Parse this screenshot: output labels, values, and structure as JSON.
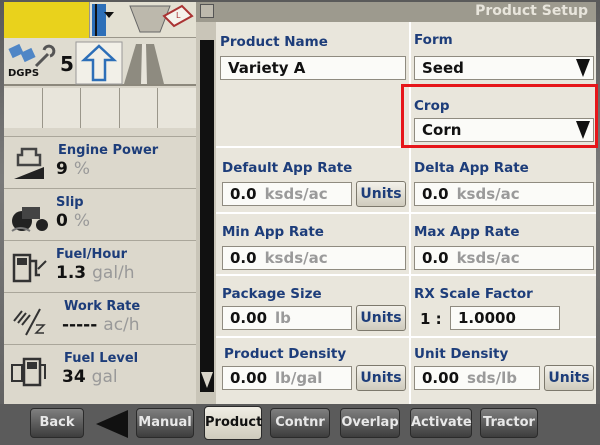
{
  "window": {
    "title": "Product Setup"
  },
  "status": {
    "gps_label": "DGPS",
    "satellite_count": "5",
    "engine_power": {
      "label": "Engine Power",
      "value": "9",
      "unit": "%"
    },
    "slip": {
      "label": "Slip",
      "value": "0",
      "unit": "%"
    },
    "fuel_hour": {
      "label": "Fuel/Hour",
      "value": "1.3",
      "unit": "gal/h"
    },
    "work_rate": {
      "label": "Work Rate",
      "value": "-----",
      "unit": "ac/h"
    },
    "fuel_level": {
      "label": "Fuel Level",
      "value": "34",
      "unit": "gal"
    }
  },
  "form": {
    "product_name": {
      "label": "Product Name",
      "value": "Variety A"
    },
    "form_type": {
      "label": "Form",
      "value": "Seed"
    },
    "crop": {
      "label": "Crop",
      "value": "Corn"
    },
    "default_app_rate": {
      "label": "Default App Rate",
      "value": "0.0",
      "unit": "ksds/ac"
    },
    "delta_app_rate": {
      "label": "Delta App Rate",
      "value": "0.0",
      "unit": "ksds/ac"
    },
    "min_app_rate": {
      "label": "Min App Rate",
      "value": "0.0",
      "unit": "ksds/ac"
    },
    "max_app_rate": {
      "label": "Max App Rate",
      "value": "0.0",
      "unit": "ksds/ac"
    },
    "package_size": {
      "label": "Package Size",
      "value": "0.00",
      "unit": "lb"
    },
    "rx_scale_factor": {
      "label": "RX Scale Factor",
      "prefix": "1 :",
      "value": "1.0000"
    },
    "product_density": {
      "label": "Product Density",
      "value": "0.00",
      "unit": "lb/gal"
    },
    "unit_density": {
      "label": "Unit Density",
      "value": "0.00",
      "unit": "sds/lb"
    },
    "units_button_label": "Units"
  },
  "nav": {
    "back": "Back",
    "manual": "Manual",
    "product": "Product",
    "contnr": "Contnr",
    "overlap": "Overlap",
    "activate": "Activate",
    "tractor": "Tractor"
  },
  "colors": {
    "highlight": "#e6161a",
    "label_blue": "#1d3d7a",
    "status_yellow": "#e9d21c"
  }
}
